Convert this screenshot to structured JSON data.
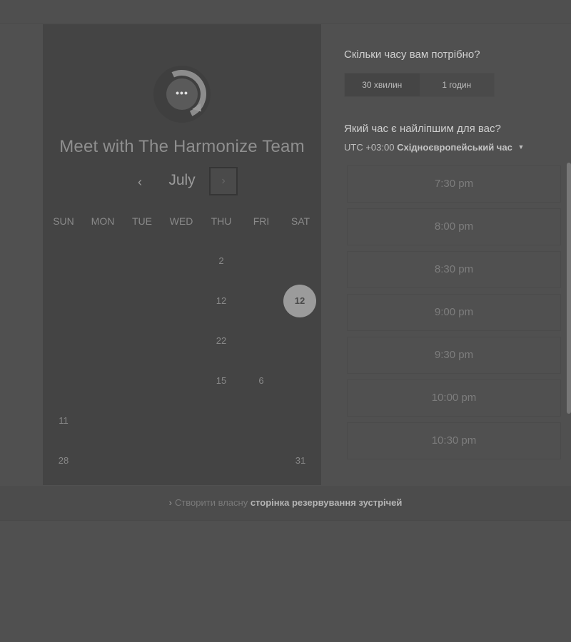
{
  "header": {
    "title": "Meet with The Harmonize Team"
  },
  "calendar": {
    "month": "July",
    "prev_label": "‹",
    "next_label": "›",
    "weekdays": [
      "SUN",
      "MON",
      "TUE",
      "WED",
      "THU",
      "FRI",
      "SAT"
    ],
    "days": [
      "2",
      "12",
      "12",
      "22",
      "15",
      "6",
      "11",
      "28",
      "31"
    ],
    "selected_day": "12"
  },
  "booking": {
    "duration_question": "Скільки часу вам потрібно?",
    "durations": [
      "30 хвилин",
      "1 годин"
    ],
    "time_question": "Який час є найліпшим для вас?",
    "timezone_prefix": "UTC +03:00",
    "timezone_name": "Східноєвропейський час",
    "slots": [
      "7:30 pm",
      "8:00 pm",
      "8:30 pm",
      "9:00 pm",
      "9:30 pm",
      "10:00 pm",
      "10:30 pm"
    ]
  },
  "footer": {
    "arrow": "›",
    "text": "Створити власну",
    "link": "сторінка резервування зустрічей"
  }
}
